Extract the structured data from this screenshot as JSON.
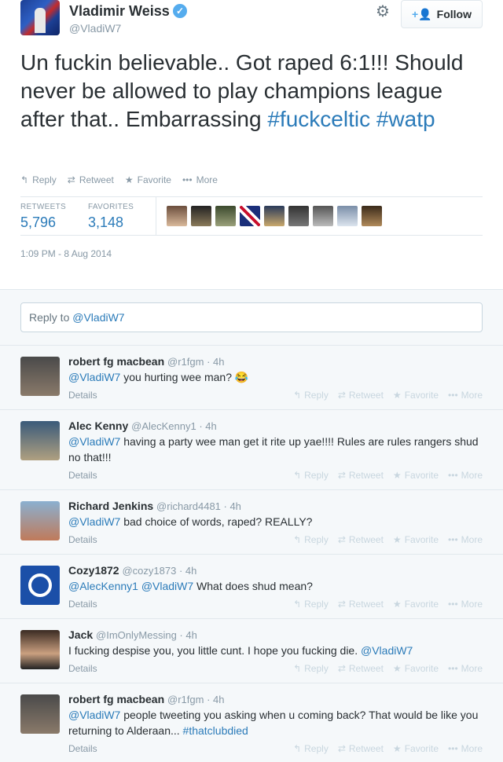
{
  "tweet": {
    "fullname": "Vladimir Weiss",
    "handle": "@VladiW7",
    "follow_label": "Follow",
    "text_plain": "Un fuckin believable.. Got raped 6:1!!! Should never be allowed to play champions league after that.. Embarrassing ",
    "hashtag1": "#fuckceltic",
    "hashtag2": "#watp",
    "actions": [
      "Reply",
      "Retweet",
      "Favorite",
      "More"
    ],
    "retweets_label": "RETWEETS",
    "retweets": "5,796",
    "favorites_label": "FAVORITES",
    "favorites": "3,148",
    "timestamp": "1:09 PM - 8 Aug 2014"
  },
  "reply_box": {
    "prefix": "Reply to ",
    "mention": "@VladiW7"
  },
  "reply_actions": [
    "Reply",
    "Retweet",
    "Favorite",
    "More"
  ],
  "details_label": "Details",
  "replies": [
    {
      "name": "robert fg macbean",
      "meta": "@r1fgm · 4h",
      "mention": "@VladiW7",
      "text": " you hurting wee man? 😂"
    },
    {
      "name": "Alec Kenny",
      "meta": "@AlecKenny1 · 4h",
      "mention": "@VladiW7",
      "text": " having a party wee man get it rite up yae!!!! Rules are rules rangers shud no that!!!"
    },
    {
      "name": "Richard Jenkins",
      "meta": "@richard4481 · 4h",
      "mention": "@VladiW7",
      "text": " bad choice of words, raped? REALLY?"
    },
    {
      "name": "Cozy1872",
      "meta": "@cozy1873 · 4h",
      "mention": "@AlecKenny1 @VladiW7",
      "text": " What does shud mean?"
    },
    {
      "name": "Jack",
      "meta": "@ImOnlyMessing · 4h",
      "text_before": "I fucking despise you, you little cunt. I hope you fucking die. ",
      "mention_after": "@VladiW7"
    },
    {
      "name": "robert fg macbean",
      "meta": "@r1fgm · 4h",
      "mention": "@VladiW7",
      "text": " people tweeting you asking when u coming back? That would be like you returning to Alderaan... ",
      "tag": "#thatclubdied"
    }
  ],
  "colors": {
    "link": "#2b7bb9",
    "verified": "#55acee",
    "muted": "#8899a6",
    "bg_replies": "#f5f8fa"
  },
  "icons": [
    "verified-icon",
    "gear-icon",
    "follow-person-icon",
    "reply-icon",
    "retweet-icon",
    "star-icon",
    "more-icon"
  ]
}
